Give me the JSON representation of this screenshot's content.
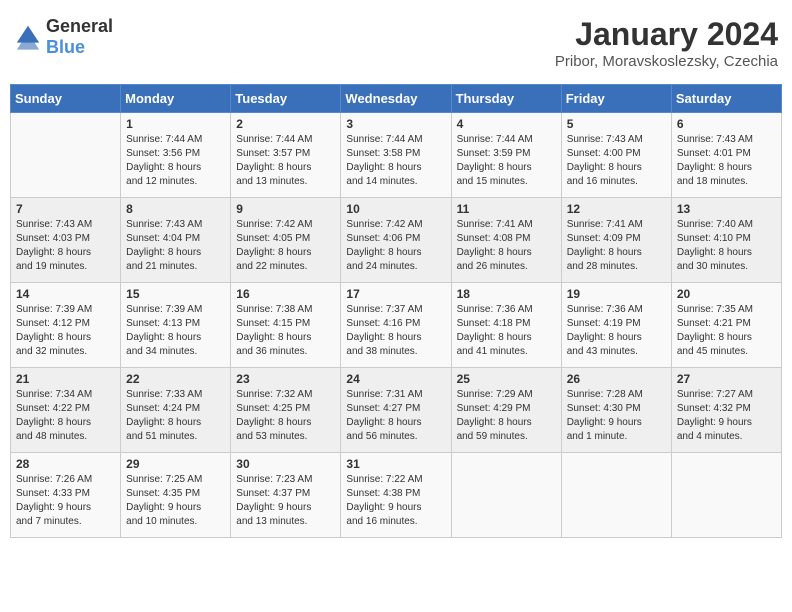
{
  "logo": {
    "general": "General",
    "blue": "Blue"
  },
  "title": "January 2024",
  "subtitle": "Pribor, Moravskoslezsky, Czechia",
  "days": [
    "Sunday",
    "Monday",
    "Tuesday",
    "Wednesday",
    "Thursday",
    "Friday",
    "Saturday"
  ],
  "weeks": [
    [
      {
        "day": "",
        "content": ""
      },
      {
        "day": "1",
        "content": "Sunrise: 7:44 AM\nSunset: 3:56 PM\nDaylight: 8 hours\nand 12 minutes."
      },
      {
        "day": "2",
        "content": "Sunrise: 7:44 AM\nSunset: 3:57 PM\nDaylight: 8 hours\nand 13 minutes."
      },
      {
        "day": "3",
        "content": "Sunrise: 7:44 AM\nSunset: 3:58 PM\nDaylight: 8 hours\nand 14 minutes."
      },
      {
        "day": "4",
        "content": "Sunrise: 7:44 AM\nSunset: 3:59 PM\nDaylight: 8 hours\nand 15 minutes."
      },
      {
        "day": "5",
        "content": "Sunrise: 7:43 AM\nSunset: 4:00 PM\nDaylight: 8 hours\nand 16 minutes."
      },
      {
        "day": "6",
        "content": "Sunrise: 7:43 AM\nSunset: 4:01 PM\nDaylight: 8 hours\nand 18 minutes."
      }
    ],
    [
      {
        "day": "7",
        "content": "Sunrise: 7:43 AM\nSunset: 4:03 PM\nDaylight: 8 hours\nand 19 minutes."
      },
      {
        "day": "8",
        "content": "Sunrise: 7:43 AM\nSunset: 4:04 PM\nDaylight: 8 hours\nand 21 minutes."
      },
      {
        "day": "9",
        "content": "Sunrise: 7:42 AM\nSunset: 4:05 PM\nDaylight: 8 hours\nand 22 minutes."
      },
      {
        "day": "10",
        "content": "Sunrise: 7:42 AM\nSunset: 4:06 PM\nDaylight: 8 hours\nand 24 minutes."
      },
      {
        "day": "11",
        "content": "Sunrise: 7:41 AM\nSunset: 4:08 PM\nDaylight: 8 hours\nand 26 minutes."
      },
      {
        "day": "12",
        "content": "Sunrise: 7:41 AM\nSunset: 4:09 PM\nDaylight: 8 hours\nand 28 minutes."
      },
      {
        "day": "13",
        "content": "Sunrise: 7:40 AM\nSunset: 4:10 PM\nDaylight: 8 hours\nand 30 minutes."
      }
    ],
    [
      {
        "day": "14",
        "content": "Sunrise: 7:39 AM\nSunset: 4:12 PM\nDaylight: 8 hours\nand 32 minutes."
      },
      {
        "day": "15",
        "content": "Sunrise: 7:39 AM\nSunset: 4:13 PM\nDaylight: 8 hours\nand 34 minutes."
      },
      {
        "day": "16",
        "content": "Sunrise: 7:38 AM\nSunset: 4:15 PM\nDaylight: 8 hours\nand 36 minutes."
      },
      {
        "day": "17",
        "content": "Sunrise: 7:37 AM\nSunset: 4:16 PM\nDaylight: 8 hours\nand 38 minutes."
      },
      {
        "day": "18",
        "content": "Sunrise: 7:36 AM\nSunset: 4:18 PM\nDaylight: 8 hours\nand 41 minutes."
      },
      {
        "day": "19",
        "content": "Sunrise: 7:36 AM\nSunset: 4:19 PM\nDaylight: 8 hours\nand 43 minutes."
      },
      {
        "day": "20",
        "content": "Sunrise: 7:35 AM\nSunset: 4:21 PM\nDaylight: 8 hours\nand 45 minutes."
      }
    ],
    [
      {
        "day": "21",
        "content": "Sunrise: 7:34 AM\nSunset: 4:22 PM\nDaylight: 8 hours\nand 48 minutes."
      },
      {
        "day": "22",
        "content": "Sunrise: 7:33 AM\nSunset: 4:24 PM\nDaylight: 8 hours\nand 51 minutes."
      },
      {
        "day": "23",
        "content": "Sunrise: 7:32 AM\nSunset: 4:25 PM\nDaylight: 8 hours\nand 53 minutes."
      },
      {
        "day": "24",
        "content": "Sunrise: 7:31 AM\nSunset: 4:27 PM\nDaylight: 8 hours\nand 56 minutes."
      },
      {
        "day": "25",
        "content": "Sunrise: 7:29 AM\nSunset: 4:29 PM\nDaylight: 8 hours\nand 59 minutes."
      },
      {
        "day": "26",
        "content": "Sunrise: 7:28 AM\nSunset: 4:30 PM\nDaylight: 9 hours\nand 1 minute."
      },
      {
        "day": "27",
        "content": "Sunrise: 7:27 AM\nSunset: 4:32 PM\nDaylight: 9 hours\nand 4 minutes."
      }
    ],
    [
      {
        "day": "28",
        "content": "Sunrise: 7:26 AM\nSunset: 4:33 PM\nDaylight: 9 hours\nand 7 minutes."
      },
      {
        "day": "29",
        "content": "Sunrise: 7:25 AM\nSunset: 4:35 PM\nDaylight: 9 hours\nand 10 minutes."
      },
      {
        "day": "30",
        "content": "Sunrise: 7:23 AM\nSunset: 4:37 PM\nDaylight: 9 hours\nand 13 minutes."
      },
      {
        "day": "31",
        "content": "Sunrise: 7:22 AM\nSunset: 4:38 PM\nDaylight: 9 hours\nand 16 minutes."
      },
      {
        "day": "",
        "content": ""
      },
      {
        "day": "",
        "content": ""
      },
      {
        "day": "",
        "content": ""
      }
    ]
  ]
}
